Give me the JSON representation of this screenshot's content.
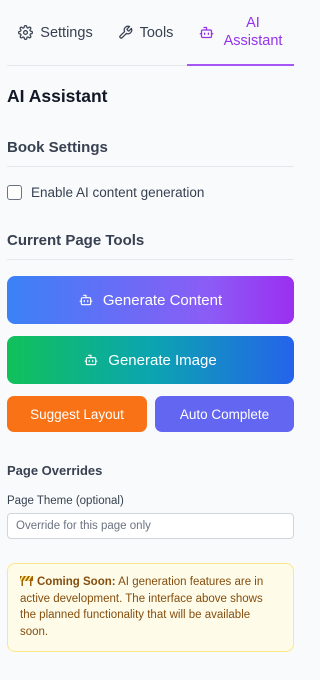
{
  "tabs": [
    {
      "label": "Settings",
      "icon": "gear-icon"
    },
    {
      "label": "Tools",
      "icon": "wrench-icon"
    },
    {
      "label": "AI\nAssistant",
      "icon": "bot-icon",
      "active": true
    }
  ],
  "panel_title": "AI Assistant",
  "book_settings": {
    "heading": "Book Settings",
    "enable_ai_label": "Enable AI content generation",
    "enable_ai_checked": false
  },
  "page_tools": {
    "heading": "Current Page Tools",
    "generate_content_label": "Generate Content",
    "generate_image_label": "Generate Image",
    "suggest_layout_label": "Suggest Layout",
    "auto_complete_label": "Auto Complete"
  },
  "overrides": {
    "heading": "Page Overrides",
    "theme_label": "Page Theme (optional)",
    "theme_value": "",
    "theme_placeholder": "Override for this page only"
  },
  "notice": {
    "icon": "construction-icon",
    "title": "Coming Soon:",
    "text": " AI generation features are in active development. The interface above shows the planned functionality that will be available soon."
  },
  "colors": {
    "accent": "#9333ea",
    "content_gradient": [
      "#3b82f6",
      "#9b2ff0"
    ],
    "image_gradient": [
      "#10c15a",
      "#2563eb"
    ],
    "suggest": "#f97316",
    "auto": "#6366f1",
    "notice_bg": "#fefce8"
  }
}
